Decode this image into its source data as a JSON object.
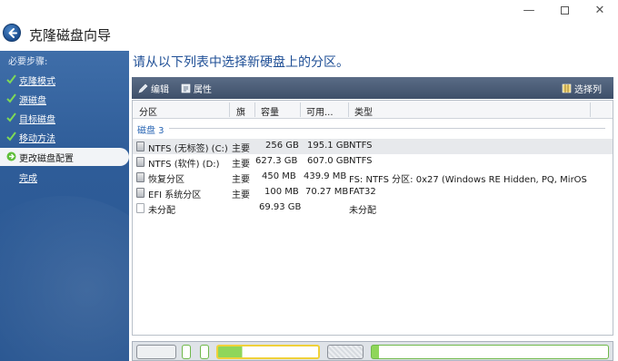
{
  "window": {
    "title": "克隆磁盘向导",
    "controls": {
      "minimize": "—",
      "close": "✕"
    }
  },
  "sidebar": {
    "heading": "必要步骤:",
    "steps": [
      {
        "label": "克隆模式",
        "state": "done"
      },
      {
        "label": "源磁盘",
        "state": "done"
      },
      {
        "label": "目标磁盘",
        "state": "done"
      },
      {
        "label": "移动方法",
        "state": "done"
      },
      {
        "label": "更改磁盘配置",
        "state": "current"
      },
      {
        "label": "完成",
        "state": "pending"
      }
    ]
  },
  "main": {
    "heading": "请从以下列表中选择新硬盘上的分区。",
    "toolbar": {
      "edit": "编辑",
      "properties": "属性",
      "choose_columns": "选择列"
    },
    "columns": [
      "分区",
      "旗",
      "容量",
      "可用...",
      "类型"
    ],
    "group": "磁盘 3",
    "rows": [
      {
        "partition": "NTFS (无标签) (C:)",
        "flag": "主要",
        "capacity": "256 GB",
        "free": "195.1 GB",
        "type": "NTFS",
        "selected": true
      },
      {
        "partition": "NTFS (软件) (D:)",
        "flag": "主要",
        "capacity": "627.3 GB",
        "free": "607.0 GB",
        "type": "NTFS",
        "selected": false
      },
      {
        "partition": "恢复分区",
        "flag": "主要",
        "capacity": "450 MB",
        "free": "439.9 MB",
        "type": "FS: NTFS 分区: 0x27 (Windows RE Hidden, PQ, MirOS",
        "selected": false
      },
      {
        "partition": "EFI 系统分区",
        "flag": "主要",
        "capacity": "100 MB",
        "free": "70.27 MB",
        "type": "FAT32",
        "selected": false
      },
      {
        "partition": "未分配",
        "flag": "",
        "capacity": "69.93 GB",
        "free": "",
        "type": "未分配",
        "selected": false
      }
    ]
  },
  "colors": {
    "sidebar": "#2e5c98",
    "heading": "#1f4f96",
    "toolbar": "#4a5b75",
    "check": "#7ed957",
    "segment_green": "#8fd65a",
    "segment_yellow": "#f0d13a"
  }
}
